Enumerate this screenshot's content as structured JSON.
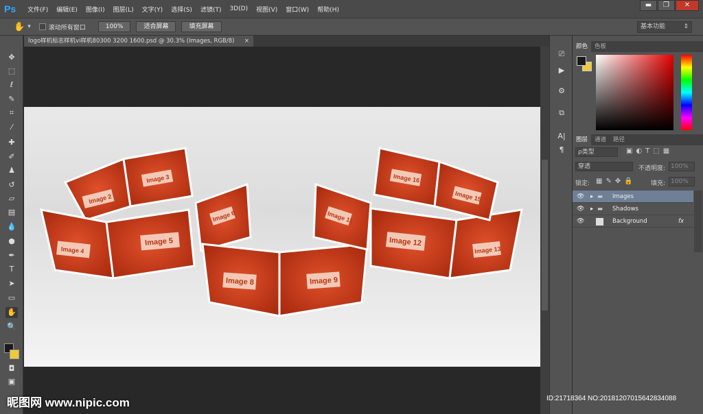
{
  "app": {
    "logo": "Ps",
    "menus": [
      "文件(F)",
      "编辑(E)",
      "图像(I)",
      "图层(L)",
      "文字(Y)",
      "选择(S)",
      "滤镜(T)",
      "3D(D)",
      "视图(V)",
      "窗口(W)",
      "帮助(H)"
    ],
    "window_controls": {
      "minimize": "▬",
      "restore": "❐",
      "close": "✕"
    }
  },
  "options": {
    "scroll_all_label": "滚动所有窗口",
    "zoom_btn": "100%",
    "fit_btn": "适合屏幕",
    "fill_btn": "填充屏幕",
    "workspace": "基本功能"
  },
  "document": {
    "tab_title": "logo样机标志样机vi样机80300 3200 1600.psd @ 30.3% (Images, RGB/8)",
    "tab_close": "×",
    "image_labels": [
      "Image 2",
      "Image 3",
      "Image 4",
      "Image 5",
      "Image 6",
      "Image 8",
      "Image 9",
      "Image 11",
      "Image 12",
      "Image 13",
      "Image 15",
      "Image 16"
    ]
  },
  "color_panel": {
    "tabs": [
      "颜色",
      "色板"
    ],
    "fg": "#1a1a1a",
    "bg": "#f0c93c"
  },
  "layers_panel": {
    "tabs": [
      "图层",
      "通道",
      "路径"
    ],
    "filter_label": "ρ类型",
    "blend_mode": "穿透",
    "opacity_label": "不透明度:",
    "opacity_value": "100%",
    "lock_label": "锁定:",
    "fill_label": "填充:",
    "fill_value": "100%",
    "layers": [
      {
        "name": "Images",
        "type": "group",
        "selected": true
      },
      {
        "name": "Shadows",
        "type": "group",
        "selected": false
      },
      {
        "name": "Background",
        "type": "layer",
        "selected": false,
        "fx": "fx"
      }
    ]
  },
  "watermark": {
    "text": "昵图网 www.nipic.com",
    "id": "ID:21718364 NO:20181207015642834088"
  }
}
